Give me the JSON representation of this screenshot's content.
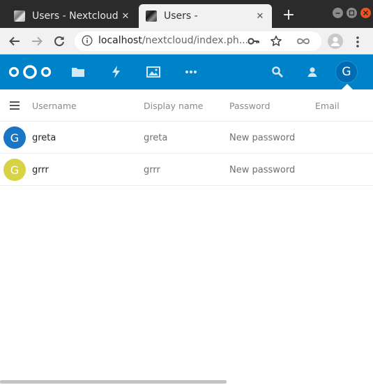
{
  "browser": {
    "tabs": [
      {
        "title": "Users - Nextcloud",
        "active": false
      },
      {
        "title": "Users -",
        "active": true
      }
    ],
    "new_tab_label": "+",
    "close_glyph": "✕",
    "url": {
      "host": "localhost",
      "path": "/nextcloud/index.ph..."
    },
    "colors": {
      "tabstrip": "#2b2b2b",
      "toolbar": "#f1f1f1",
      "close_button": "#e95420"
    }
  },
  "nextcloud": {
    "header_color": "#0082c9",
    "apps": [
      "files-icon",
      "activity-icon",
      "gallery-icon",
      "more-apps-icon"
    ],
    "right_icons": [
      "search-icon",
      "contacts-icon"
    ],
    "user_avatar_letter": "G"
  },
  "users_table": {
    "columns": [
      "Username",
      "Display name",
      "Password",
      "Email"
    ],
    "rows": [
      {
        "avatar_letter": "G",
        "avatar_color": "#1a75c4",
        "username": "greta",
        "display_name": "greta",
        "password_placeholder": "New password"
      },
      {
        "avatar_letter": "G",
        "avatar_color": "#d8d245",
        "username": "grrr",
        "display_name": "grrr",
        "password_placeholder": "New password"
      }
    ]
  }
}
